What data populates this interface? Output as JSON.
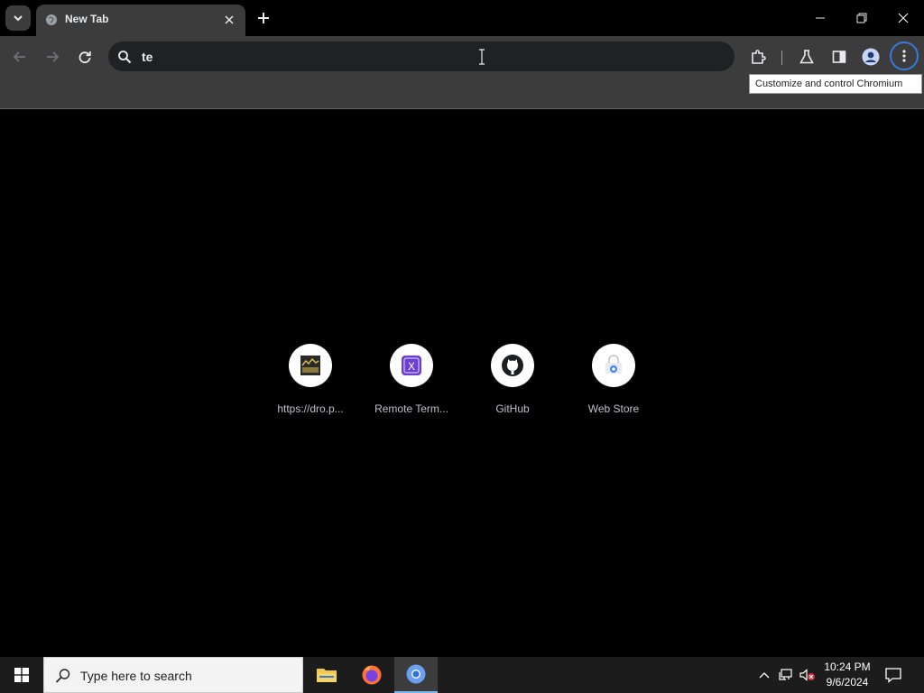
{
  "browser": {
    "tab": {
      "title": "New Tab"
    },
    "omnibox": {
      "value": "te"
    },
    "tooltip": "Customize and control Chromium"
  },
  "shortcuts": [
    {
      "label": "https://dro.p...",
      "icon": "dro-site-icon"
    },
    {
      "label": "Remote Term...",
      "icon": "remote-terminal-icon"
    },
    {
      "label": "GitHub",
      "icon": "github-icon"
    },
    {
      "label": "Web Store",
      "icon": "web-store-icon"
    }
  ],
  "taskbar": {
    "search_placeholder": "Type here to search",
    "apps": [
      "file-explorer",
      "firefox",
      "chromium"
    ],
    "clock": {
      "time": "10:24 PM",
      "date": "9/6/2024"
    }
  },
  "colors": {
    "page_bg": "#000000",
    "toolbar_bg": "#3c3c3c",
    "omnibox_bg": "#202124",
    "focus_ring": "#3a78d6",
    "taskbar_bg": "#1c1c1c"
  }
}
